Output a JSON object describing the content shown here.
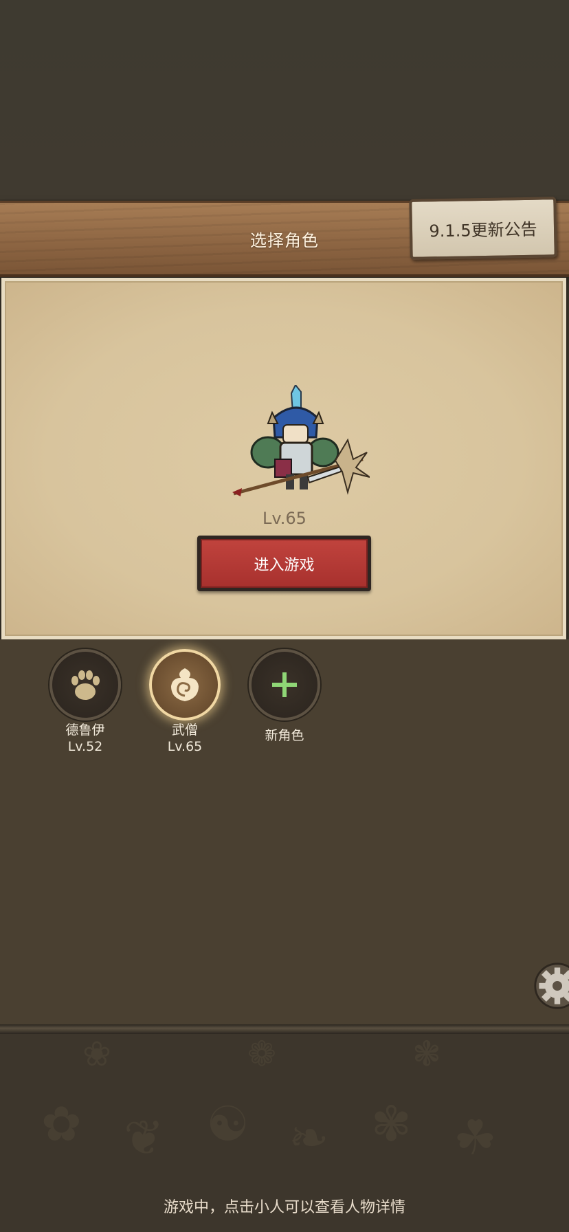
{
  "header": {
    "title": "选择角色",
    "notice_label": "9.1.5更新公告"
  },
  "selected_hero": {
    "level": "Lv.65",
    "enter_label": "进入游戏"
  },
  "characters": [
    {
      "name": "德鲁伊",
      "level": "Lv.52",
      "icon": "paw-icon",
      "active": false
    },
    {
      "name": "武僧",
      "level": "Lv.65",
      "icon": "swirl-icon",
      "active": true
    },
    {
      "name": "新角色",
      "level": "",
      "icon": "plus-icon",
      "active": false
    }
  ],
  "footer": {
    "tip": "游戏中，点击小人可以查看人物详情"
  },
  "colors": {
    "accent_red": "#b43a35",
    "plus_green": "#8fd676"
  }
}
